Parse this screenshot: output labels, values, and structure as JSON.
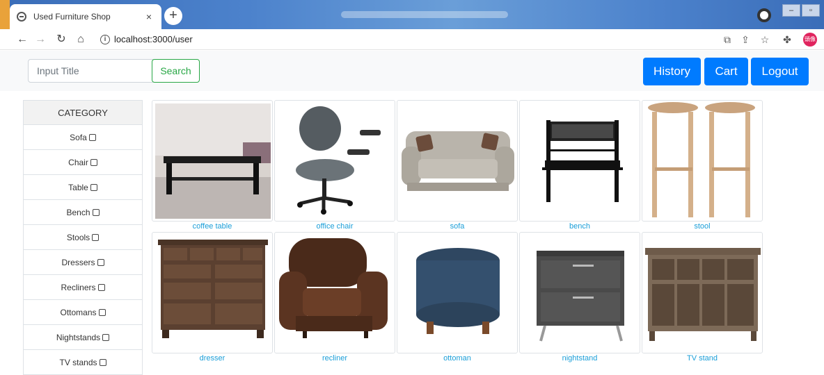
{
  "browser": {
    "tab_title": "Used Furniture Shop",
    "tab_close": "×",
    "new_tab": "+",
    "url": "localhost:3000/user",
    "avatar_text": "頭像"
  },
  "header": {
    "search_placeholder": "Input Title",
    "search_label": "Search",
    "history_label": "History",
    "cart_label": "Cart",
    "logout_label": "Logout"
  },
  "sidebar": {
    "title": "CATEGORY",
    "items": [
      {
        "label": "Sofa",
        "checked": false
      },
      {
        "label": "Chair",
        "checked": false
      },
      {
        "label": "Table",
        "checked": false
      },
      {
        "label": "Bench",
        "checked": false
      },
      {
        "label": "Stools",
        "checked": false
      },
      {
        "label": "Dressers",
        "checked": false
      },
      {
        "label": "Recliners",
        "checked": false
      },
      {
        "label": "Ottomans",
        "checked": false
      },
      {
        "label": "Nightstands",
        "checked": false
      },
      {
        "label": "TV stands",
        "checked": false
      }
    ]
  },
  "products": [
    {
      "title": "coffee table"
    },
    {
      "title": "office chair"
    },
    {
      "title": "sofa"
    },
    {
      "title": "bench"
    },
    {
      "title": "stool"
    },
    {
      "title": "dresser"
    },
    {
      "title": "recliner"
    },
    {
      "title": "ottoman"
    },
    {
      "title": "nightstand"
    },
    {
      "title": "TV stand"
    }
  ],
  "colors": {
    "primary": "#007bff",
    "success": "#28a745",
    "link": "#1a9ed8"
  }
}
